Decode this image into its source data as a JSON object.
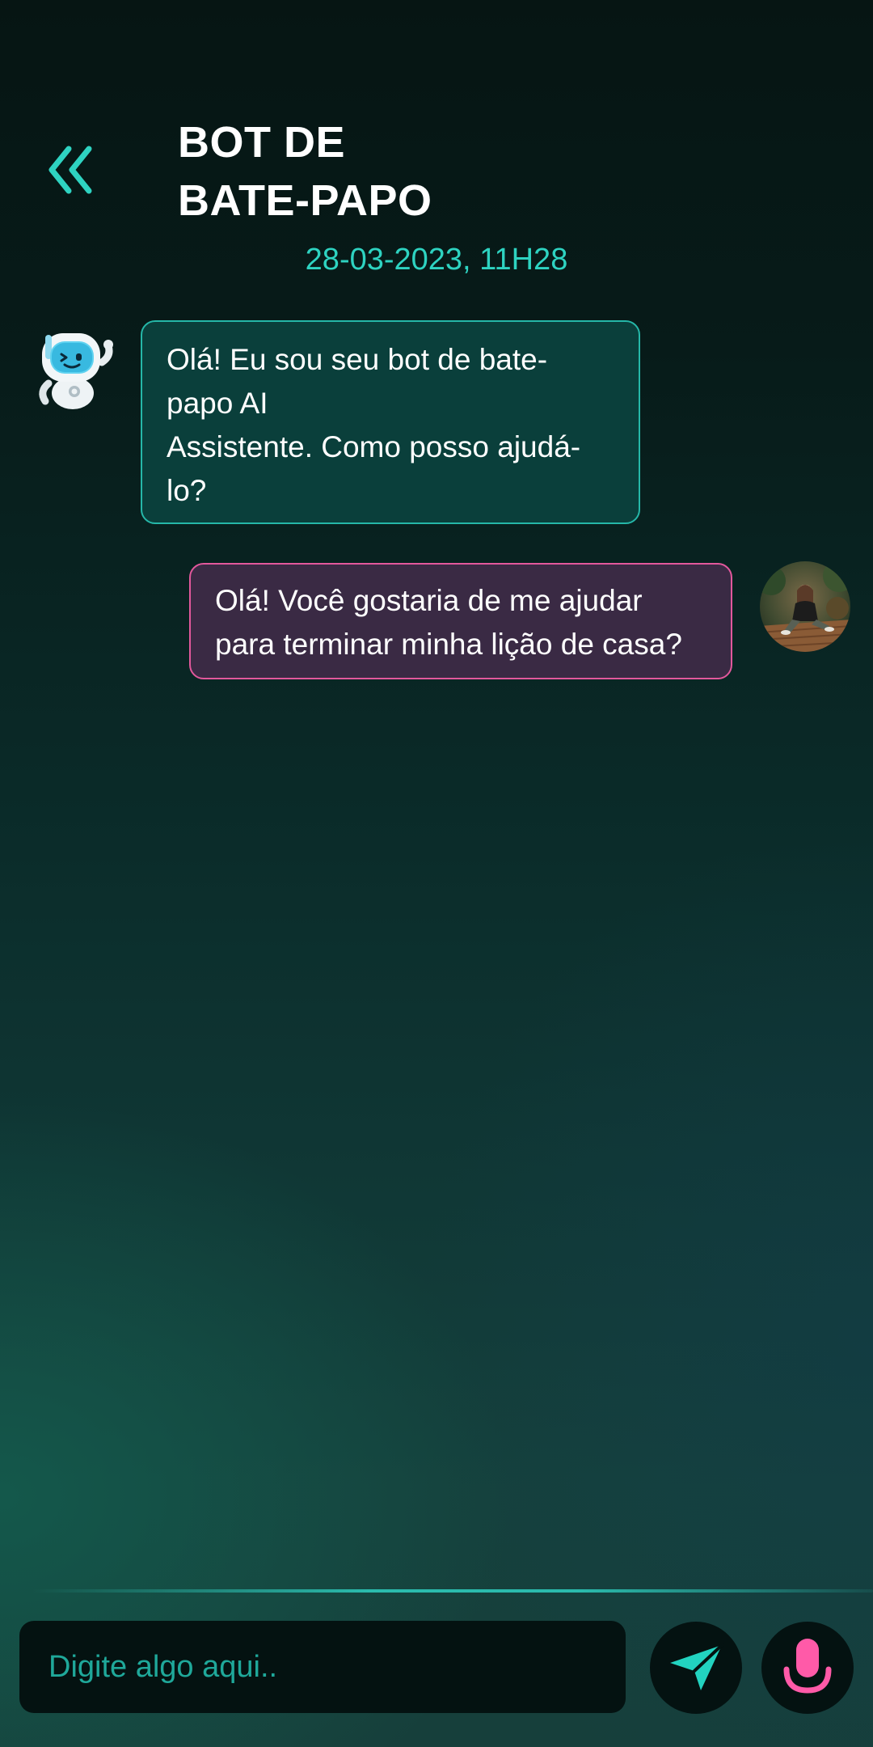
{
  "header": {
    "back_icon": "double-chevron-left-icon",
    "title_line1": "BOT DE",
    "title_line2": "BATE-PAPO",
    "timestamp": "28-03-2023, 11H28"
  },
  "messages": [
    {
      "sender": "bot",
      "avatar_icon": "robot-avatar",
      "lines": [
        "Olá! Eu sou seu bot de bate-",
        "papo AI",
        "Assistente. Como posso ajudá-",
        "lo?"
      ]
    },
    {
      "sender": "user",
      "avatar_icon": "user-avatar-photo",
      "lines": [
        "Olá! Você gostaria de me ajudar",
        "para terminar minha lição de casa?"
      ]
    }
  ],
  "composer": {
    "placeholder": "Digite algo aqui..",
    "value": "",
    "send_icon": "paper-plane-icon",
    "mic_icon": "microphone-icon"
  },
  "colors": {
    "accent_teal": "#2ed3c1",
    "bot_bubble_bg": "#0a3f3b",
    "bot_bubble_border": "#25b7a8",
    "user_bubble_bg": "#3a2a44",
    "user_bubble_border": "#e2589c",
    "mic_pink": "#ff5aa8",
    "input_bg": "#041211"
  }
}
